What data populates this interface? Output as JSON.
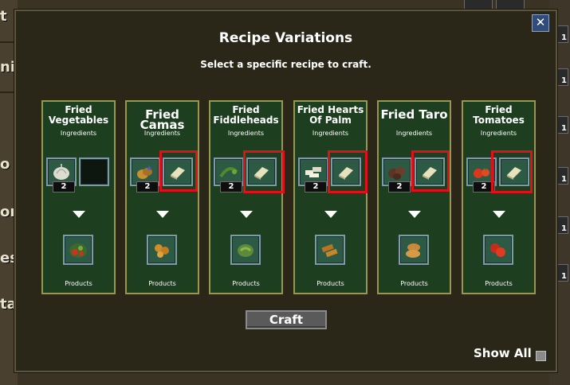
{
  "dialog": {
    "title": "Recipe Variations",
    "subtitle": "Select a specific recipe to craft.",
    "close_label": "✕",
    "craft_label": "Craft",
    "show_all_label": "Show All"
  },
  "background": {
    "left_labels": [
      "t",
      "ni",
      "o",
      "or",
      "es",
      "ta"
    ],
    "right_slot_counts": [
      "1",
      "1",
      "1",
      "1",
      "1",
      "1"
    ]
  },
  "recipes": [
    {
      "name": "Fried Vegetables",
      "ingredients_label": "Ingredients",
      "products_label": "Products",
      "qty": "2",
      "ingredient_icon": "garlic-icon",
      "second_slot": "empty",
      "product_icon": "fried-vegetables-icon",
      "highlighted": false
    },
    {
      "name": "Fried Camas",
      "ingredients_label": "Ingredients",
      "products_label": "Products",
      "qty": "2",
      "ingredient_icon": "camas-icon",
      "second_slot": "oil-icon",
      "product_icon": "fried-camas-icon",
      "highlighted": true
    },
    {
      "name": "Fried Fiddleheads",
      "ingredients_label": "Ingredients",
      "products_label": "Products",
      "qty": "2",
      "ingredient_icon": "fiddleheads-icon",
      "second_slot": "oil-icon",
      "product_icon": "fried-fiddleheads-icon",
      "highlighted": true
    },
    {
      "name": "Fried Hearts Of Palm",
      "ingredients_label": "Ingredients",
      "products_label": "Products",
      "qty": "2",
      "ingredient_icon": "hearts-of-palm-icon",
      "second_slot": "oil-icon",
      "product_icon": "fried-hearts-of-palm-icon",
      "highlighted": true
    },
    {
      "name": "Fried Taro",
      "ingredients_label": "Ingredients",
      "products_label": "Products",
      "qty": "2",
      "ingredient_icon": "taro-icon",
      "second_slot": "oil-icon",
      "product_icon": "fried-taro-icon",
      "highlighted": true
    },
    {
      "name": "Fried Tomatoes",
      "ingredients_label": "Ingredients",
      "products_label": "Products",
      "qty": "2",
      "ingredient_icon": "tomato-icon",
      "second_slot": "oil-icon",
      "product_icon": "fried-tomatoes-icon",
      "highlighted": true
    }
  ],
  "colors": {
    "card_bg": "#1d3e1f",
    "card_border": "#9a9650",
    "highlight": "#e0101a",
    "dialog_bg": "#2a2719"
  }
}
